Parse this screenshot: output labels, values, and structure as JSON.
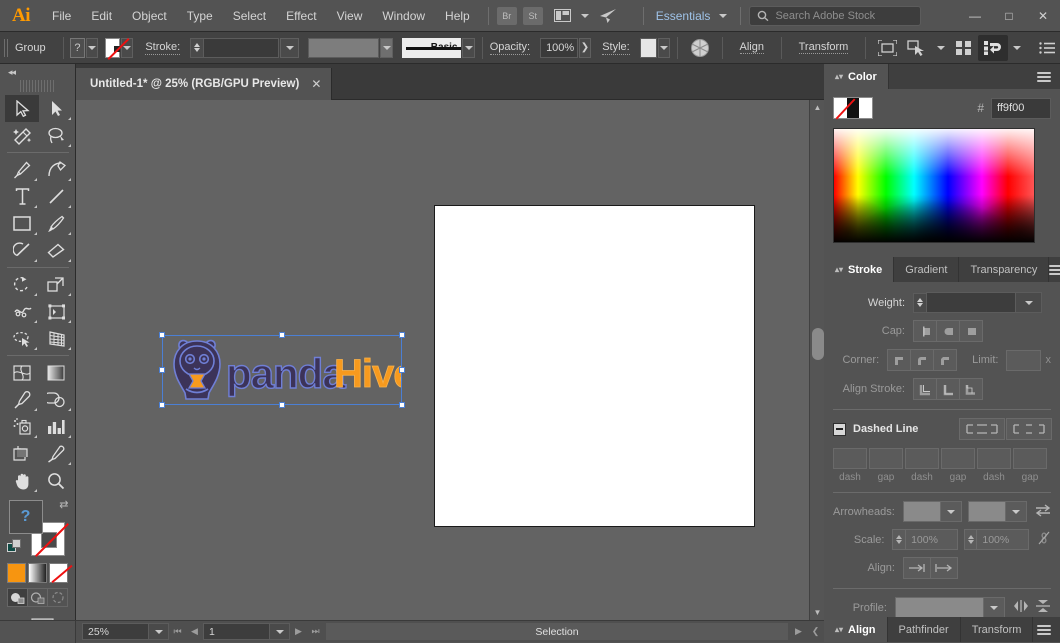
{
  "app": {
    "logo": "Ai"
  },
  "menubar": {
    "items": [
      "File",
      "Edit",
      "Object",
      "Type",
      "Select",
      "Effect",
      "View",
      "Window",
      "Help"
    ],
    "badges": [
      "Br",
      "St"
    ],
    "workspace": "Essentials",
    "search_placeholder": "Search Adobe Stock",
    "window_buttons": {
      "minimize": "—",
      "maximize": "□",
      "close": "✕"
    }
  },
  "controlbar": {
    "selection_label": "Group",
    "fill_label": "?",
    "stroke_label": "Stroke:",
    "brush_label": "Basic",
    "opacity_label": "Opacity:",
    "opacity_value": "100%",
    "style_label": "Style:",
    "align_label": "Align",
    "transform_label": "Transform"
  },
  "document": {
    "tab_title": "Untitled-1* @ 25% (RGB/GPU Preview)",
    "close_glyph": "✕"
  },
  "toolbar": {
    "collapse_glyph": "◂◂",
    "tools": [
      "selection-tool",
      "direct-selection-tool",
      "magic-wand-tool",
      "lasso-tool",
      "pen-tool",
      "curvature-tool",
      "type-tool",
      "line-segment-tool",
      "rectangle-tool",
      "paintbrush-tool",
      "shaper-tool",
      "eraser-tool",
      "rotate-tool",
      "scale-tool",
      "width-tool",
      "free-transform-tool",
      "shape-builder-tool",
      "perspective-grid-tool",
      "mesh-tool",
      "gradient-tool",
      "eyedropper-tool",
      "blend-tool",
      "symbol-sprayer-tool",
      "column-graph-tool",
      "artboard-tool",
      "slice-tool",
      "hand-tool",
      "zoom-tool"
    ],
    "fill_glyph": "?",
    "swap_glyph": "⇄",
    "color_modes": [
      "color-mode",
      "gradient-mode",
      "none-mode"
    ],
    "draw_modes": [
      "draw-normal",
      "draw-behind",
      "draw-inside"
    ]
  },
  "canvas": {
    "logo_text_1": "panda",
    "logo_text_2": "Hive",
    "logo_colors": {
      "text1": "#3c3359",
      "text2": "#f79a1e",
      "outline": "#6f7fd6",
      "panda": "#3c3359"
    }
  },
  "statusbar": {
    "zoom": "25%",
    "page": "1",
    "status": "Selection"
  },
  "panels": {
    "color": {
      "tabs": [
        {
          "label": "Color",
          "active": true
        }
      ],
      "hash": "#",
      "hex_value": "ff9f00"
    },
    "stroke": {
      "tabs": [
        {
          "label": "Stroke",
          "active": true
        },
        {
          "label": "Gradient",
          "active": false
        },
        {
          "label": "Transparency",
          "active": false
        }
      ],
      "weight_label": "Weight:",
      "weight_value": "",
      "cap_label": "Cap:",
      "corner_label": "Corner:",
      "limit_label": "Limit:",
      "limit_value": "",
      "limit_unit": "x",
      "align_stroke_label": "Align Stroke:",
      "dashed_line_label": "Dashed Line",
      "dash_fields": [
        "dash",
        "gap",
        "dash",
        "gap",
        "dash",
        "gap"
      ],
      "arrowheads_label": "Arrowheads:",
      "scale_label": "Scale:",
      "scale_value_1": "100%",
      "scale_value_2": "100%",
      "align_label": "Align:",
      "profile_label": "Profile:"
    },
    "bottom": {
      "tabs": [
        {
          "label": "Align",
          "active": true
        },
        {
          "label": "Pathfinder",
          "active": false
        },
        {
          "label": "Transform",
          "active": false
        }
      ]
    }
  }
}
